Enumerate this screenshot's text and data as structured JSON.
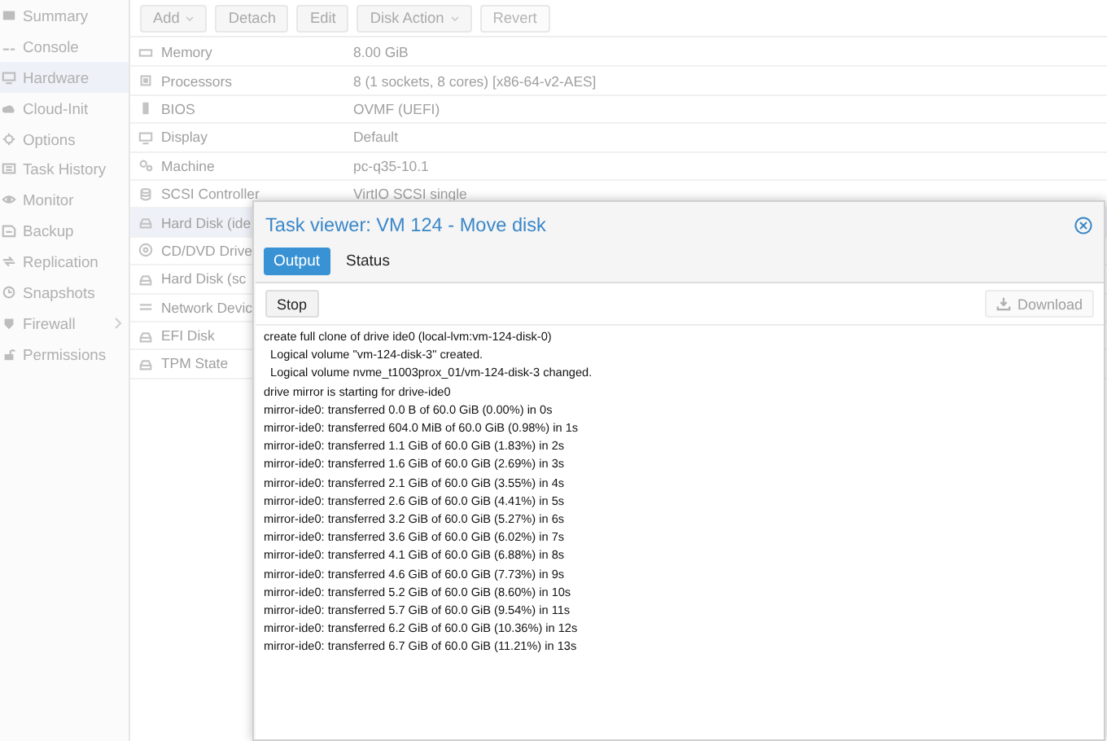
{
  "sidebar": {
    "items": [
      {
        "label": "Summary",
        "selected": false,
        "expandable": false
      },
      {
        "label": "Console",
        "selected": false,
        "expandable": false
      },
      {
        "label": "Hardware",
        "selected": true,
        "expandable": false
      },
      {
        "label": "Cloud-Init",
        "selected": false,
        "expandable": false
      },
      {
        "label": "Options",
        "selected": false,
        "expandable": false
      },
      {
        "label": "Task History",
        "selected": false,
        "expandable": false
      },
      {
        "label": "Monitor",
        "selected": false,
        "expandable": false
      },
      {
        "label": "Backup",
        "selected": false,
        "expandable": false
      },
      {
        "label": "Replication",
        "selected": false,
        "expandable": false
      },
      {
        "label": "Snapshots",
        "selected": false,
        "expandable": false
      },
      {
        "label": "Firewall",
        "selected": false,
        "expandable": true
      },
      {
        "label": "Permissions",
        "selected": false,
        "expandable": false
      }
    ]
  },
  "toolbar": {
    "buttons": [
      {
        "label": "Add",
        "menu": true,
        "disabled": false
      },
      {
        "label": "Detach",
        "menu": false,
        "disabled": false
      },
      {
        "label": "Edit",
        "menu": false,
        "disabled": false
      },
      {
        "label": "Disk Action",
        "menu": true,
        "disabled": false
      },
      {
        "label": "Revert",
        "menu": false,
        "disabled": true
      }
    ]
  },
  "hardware": {
    "rows": [
      {
        "name": "Memory",
        "value": "8.00 GiB",
        "selected": false
      },
      {
        "name": "Processors",
        "value": "8 (1 sockets, 8 cores) [x86-64-v2-AES]",
        "selected": false
      },
      {
        "name": "BIOS",
        "value": "OVMF (UEFI)",
        "selected": false
      },
      {
        "name": "Display",
        "value": "Default",
        "selected": false
      },
      {
        "name": "Machine",
        "value": "pc-q35-10.1",
        "selected": false
      },
      {
        "name": "SCSI Controller",
        "value": "VirtIO SCSI single",
        "selected": false
      },
      {
        "name": "Hard Disk (ide",
        "selected": true
      },
      {
        "name": "CD/DVD Drive",
        "selected": false
      },
      {
        "name": "Hard Disk (sc",
        "selected": false
      },
      {
        "name": "Network Devic",
        "selected": false
      },
      {
        "name": "EFI Disk",
        "selected": false
      },
      {
        "name": "TPM State",
        "selected": false
      }
    ]
  },
  "task_viewer": {
    "title": "Task viewer: VM 124 - Move disk",
    "tabs": [
      {
        "label": "Output",
        "selected": true
      },
      {
        "label": "Status",
        "selected": false
      }
    ],
    "buttons": [
      {
        "label": "Stop",
        "disabled": false,
        "kind": "stop"
      },
      {
        "label": "Download",
        "disabled": true,
        "kind": "download"
      }
    ],
    "log": [
      "create full clone of drive ide0 (local-lvm:vm-124-disk-0)",
      "  Logical volume \"vm-124-disk-3\" created.",
      "  Logical volume nvme_t1003prox_01/vm-124-disk-3 changed.",
      "drive mirror is starting for drive-ide0",
      "mirror-ide0: transferred 0.0 B of 60.0 GiB (0.00%) in 0s",
      "mirror-ide0: transferred 604.0 MiB of 60.0 GiB (0.98%) in 1s",
      "mirror-ide0: transferred 1.1 GiB of 60.0 GiB (1.83%) in 2s",
      "mirror-ide0: transferred 1.6 GiB of 60.0 GiB (2.69%) in 3s",
      "mirror-ide0: transferred 2.1 GiB of 60.0 GiB (3.55%) in 4s",
      "mirror-ide0: transferred 2.6 GiB of 60.0 GiB (4.41%) in 5s",
      "mirror-ide0: transferred 3.2 GiB of 60.0 GiB (5.27%) in 6s",
      "mirror-ide0: transferred 3.6 GiB of 60.0 GiB (6.02%) in 7s",
      "mirror-ide0: transferred 4.1 GiB of 60.0 GiB (6.88%) in 8s",
      "mirror-ide0: transferred 4.6 GiB of 60.0 GiB (7.73%) in 9s",
      "mirror-ide0: transferred 5.2 GiB of 60.0 GiB (8.60%) in 10s",
      "mirror-ide0: transferred 5.7 GiB of 60.0 GiB (9.54%) in 11s",
      "mirror-ide0: transferred 6.2 GiB of 60.0 GiB (10.36%) in 12s",
      "mirror-ide0: transferred 6.7 GiB of 60.0 GiB (11.21%) in 13s"
    ]
  }
}
